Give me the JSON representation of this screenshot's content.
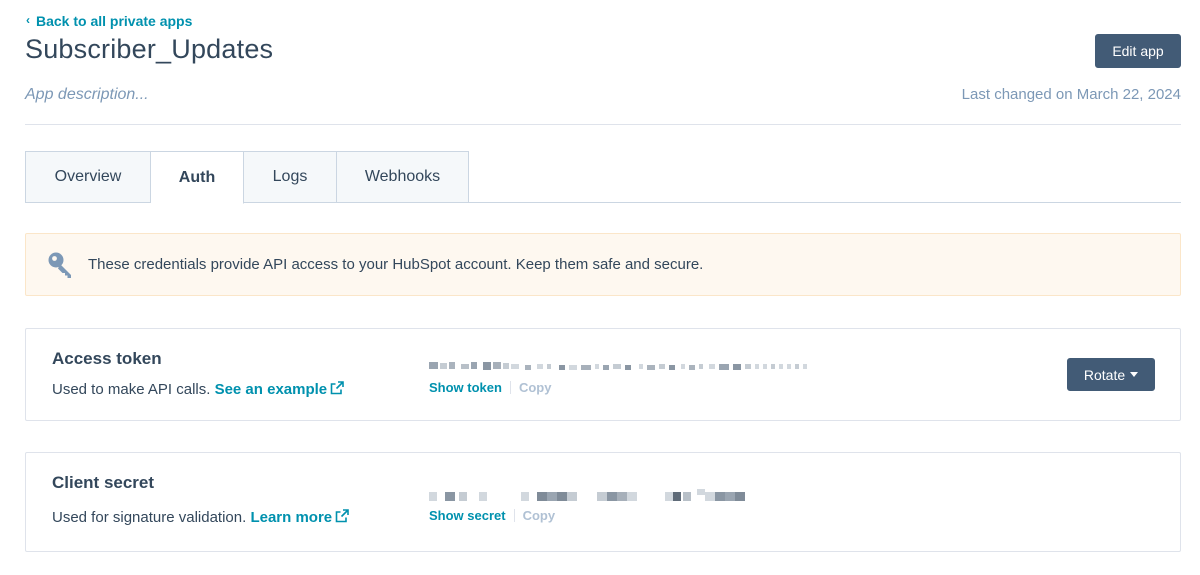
{
  "header": {
    "back_label": "Back to all private apps",
    "title": "Subscriber_Updates",
    "edit_label": "Edit app",
    "description_placeholder": "App description...",
    "last_changed": "Last changed on March 22, 2024"
  },
  "tabs": [
    {
      "label": "Overview",
      "active": false
    },
    {
      "label": "Auth",
      "active": true
    },
    {
      "label": "Logs",
      "active": false
    },
    {
      "label": "Webhooks",
      "active": false
    }
  ],
  "alert": {
    "icon": "key-icon",
    "text": "These credentials provide API access to your HubSpot account. Keep them safe and secure."
  },
  "access_token": {
    "title": "Access token",
    "description": "Used to make API calls.",
    "link_label": "See an example",
    "show_label": "Show token",
    "copy_label": "Copy",
    "rotate_label": "Rotate"
  },
  "client_secret": {
    "title": "Client secret",
    "description": "Used for signature validation.",
    "link_label": "Learn more",
    "show_label": "Show secret",
    "copy_label": "Copy"
  },
  "colors": {
    "accent_link": "#0091ae",
    "primary_button": "#425b76",
    "text": "#33475b",
    "muted": "#7c98b6",
    "alert_bg": "#fef8f0"
  }
}
